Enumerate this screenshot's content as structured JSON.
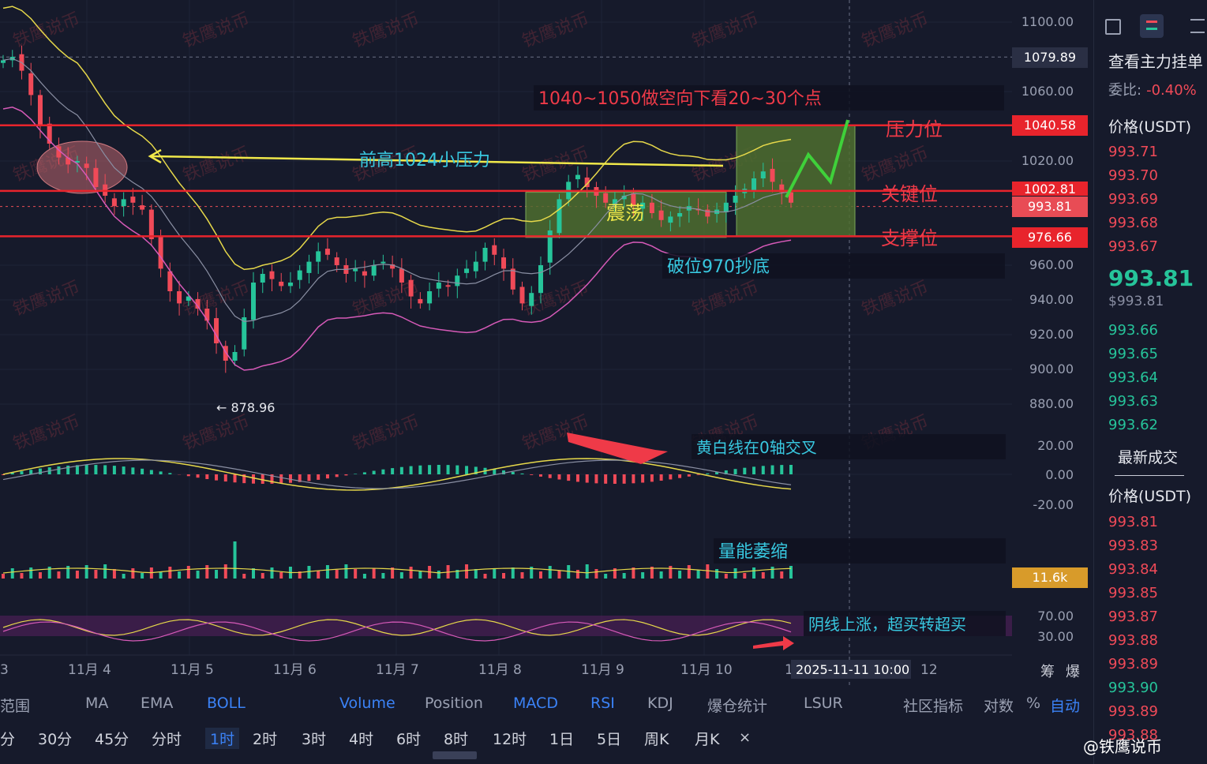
{
  "chart_data": {
    "type": "candlestick",
    "price_axis": {
      "ticks": [
        "1100.00",
        "1060.00",
        "1020.00",
        "960.00",
        "940.00",
        "920.00",
        "900.00",
        "880.00"
      ],
      "ylim": [
        868,
        1108
      ]
    },
    "x_axis": {
      "ticks": [
        "3",
        "11月 4",
        "11月 5",
        "11月 6",
        "11月 7",
        "11月 8",
        "11月 9",
        "11月 10",
        "1",
        "12"
      ],
      "crosshair_label": "2025-11-11 10:00"
    },
    "tags": {
      "crosshair": "1079.89",
      "pressure": "1040.58",
      "key": "1002.81",
      "last": "993.81",
      "support": "976.66",
      "volume": "11.6k"
    },
    "levels": {
      "pressure": 1040.58,
      "key": 1002.81,
      "support": 976.66,
      "last": 993.81
    },
    "low_label": "← 878.96",
    "close_series": [
      1078,
      1080,
      1072,
      1058,
      1040,
      1030,
      1022,
      1018,
      1020,
      1016,
      1005,
      1000,
      994,
      998,
      996,
      992,
      975,
      958,
      945,
      938,
      942,
      935,
      928,
      915,
      905,
      910,
      930,
      950,
      955,
      952,
      948,
      950,
      957,
      962,
      968,
      966,
      960,
      955,
      958,
      954,
      960,
      962,
      958,
      950,
      942,
      938,
      945,
      950,
      948,
      954,
      958,
      962,
      970,
      966,
      958,
      946,
      938,
      944,
      960,
      980,
      998,
      1008,
      1012,
      1005,
      1000,
      996,
      998,
      1000,
      994,
      996,
      990,
      986,
      988,
      990,
      994,
      992,
      988,
      992,
      996,
      1000,
      1004,
      1010,
      1014,
      1008,
      1002,
      996
    ],
    "macd_axis": [
      "20.00",
      "0.00",
      "-20.00"
    ],
    "rsi_axis": [
      "70.00",
      "30.00"
    ],
    "annotations": {
      "target": "1040~1050做空向下看20~30个点",
      "prev_high": "前高1024小压力",
      "pressure": "压力位",
      "key": "关键位",
      "support": "支撑位",
      "range": "震荡",
      "break": "破位970抄底",
      "macd_note": "黄白线在0轴交叉",
      "volume_note": "量能萎缩",
      "rsi_note": "阴线上涨，超买转超买"
    }
  },
  "right_axis_extra": {
    "left": "筹",
    "right": "爆"
  },
  "toolbar_indicators": [
    "范围",
    "MA",
    "EMA",
    "BOLL",
    "Volume",
    "Position",
    "MACD",
    "RSI",
    "KDJ",
    "爆仓统计",
    "LSUR",
    "社区指标",
    "对数",
    "%",
    "自动"
  ],
  "toolbar_intervals": [
    "分",
    "30分",
    "45分",
    "分时",
    "1时",
    "2时",
    "3时",
    "4时",
    "6时",
    "8时",
    "12时",
    "1日",
    "5日",
    "周K",
    "月K"
  ],
  "active_interval": "1时",
  "active_indicators": [
    "BOLL",
    "Volume",
    "MACD",
    "RSI",
    "自动"
  ],
  "sidebar": {
    "title": "查看主力挂单",
    "ratio_label": "委比:",
    "ratio_value": "-0.40%",
    "price_header": "价格(USDT)",
    "asks": [
      "993.71",
      "993.70",
      "993.69",
      "993.68",
      "993.67"
    ],
    "last_price": "993.81",
    "last_price_usd": "$993.81",
    "bids": [
      "993.66",
      "993.65",
      "993.64",
      "993.63",
      "993.62"
    ],
    "trades_title": "最新成交",
    "trades_header": "价格(USDT)",
    "trades": [
      {
        "p": "993.81",
        "c": "red"
      },
      {
        "p": "993.83",
        "c": "red"
      },
      {
        "p": "993.84",
        "c": "red"
      },
      {
        "p": "993.85",
        "c": "red"
      },
      {
        "p": "993.87",
        "c": "red"
      },
      {
        "p": "993.88",
        "c": "red"
      },
      {
        "p": "993.89",
        "c": "red"
      },
      {
        "p": "993.90",
        "c": "green"
      },
      {
        "p": "993.89",
        "c": "red"
      },
      {
        "p": "993.88",
        "c": "red"
      }
    ]
  },
  "watermark": "铁鹰说币",
  "brand": "@铁鹰说币",
  "colors": {
    "up": "#26c49a",
    "down": "#f04a58",
    "boll_upper": "#e6d84a",
    "boll_mid": "#8a8fa3",
    "boll_lower": "#d65ab8",
    "level": "#e8242c",
    "zone": "#4e6f2f",
    "note_cyan": "#38c8e0",
    "accent": "#3b82f6"
  }
}
